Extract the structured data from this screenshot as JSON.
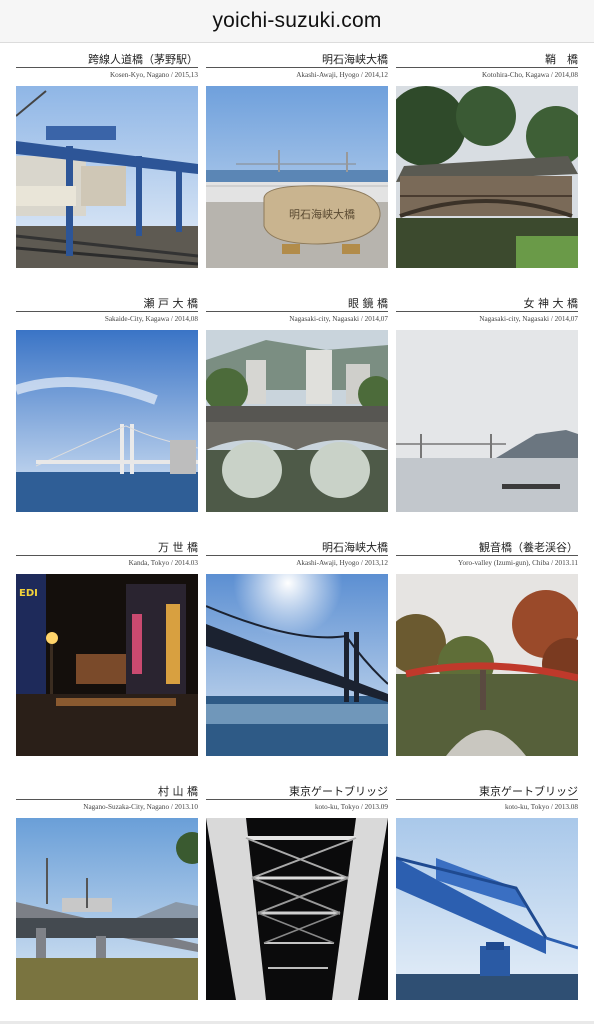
{
  "site": {
    "title": "yoichi-suzuki.com"
  },
  "cards": [
    {
      "title": "跨線人道橋（茅野駅）",
      "meta": "Kosen-Kyo, Nagano / 2015,13",
      "photo": "pedestrian-overpass-photo"
    },
    {
      "title": "明石海峡大橋",
      "meta": "Akashi-Awaji, Hyogo / 2014,12",
      "photo": "stone-monument-bridge-photo"
    },
    {
      "title": "鞘　橋",
      "meta": "Kotohira-Cho, Kagawa / 2014,08",
      "photo": "covered-bridge-photo"
    },
    {
      "title": "瀬 戸 大 橋",
      "meta": "Sakaide-City, Kagawa / 2014,08",
      "photo": "seto-bridge-photo"
    },
    {
      "title": "眼 鏡 橋",
      "meta": "Nagasaki-city, Nagasaki / 2014,07",
      "photo": "stone-arch-bridge-photo"
    },
    {
      "title": "女 神 大 橋",
      "meta": "Nagasaki-city, Nagasaki / 2014,07",
      "photo": "harbor-bridge-photo"
    },
    {
      "title": "万 世 橋",
      "meta": "Kanda, Tokyo / 2014.03",
      "photo": "night-street-photo"
    },
    {
      "title": "明石海峡大橋",
      "meta": "Akashi-Awaji, Hyogo / 2013,12",
      "photo": "suspension-bridge-backlit-photo"
    },
    {
      "title": "観音橋（養老渓谷）",
      "meta": "Yoro-valley (Izumi-gun), Chiba / 2013.11",
      "photo": "red-bridge-autumn-photo"
    },
    {
      "title": "村 山 橋",
      "meta": "Nagano-Suzaka-City, Nagano / 2013.10",
      "photo": "railway-bridge-photo"
    },
    {
      "title": "東京ゲートブリッジ",
      "meta": "koto-ku, Tokyo / 2013.09",
      "photo": "truss-interior-night-photo"
    },
    {
      "title": "東京ゲートブリッジ",
      "meta": "koto-ku, Tokyo / 2013.08",
      "photo": "blue-truss-bridge-photo"
    }
  ]
}
